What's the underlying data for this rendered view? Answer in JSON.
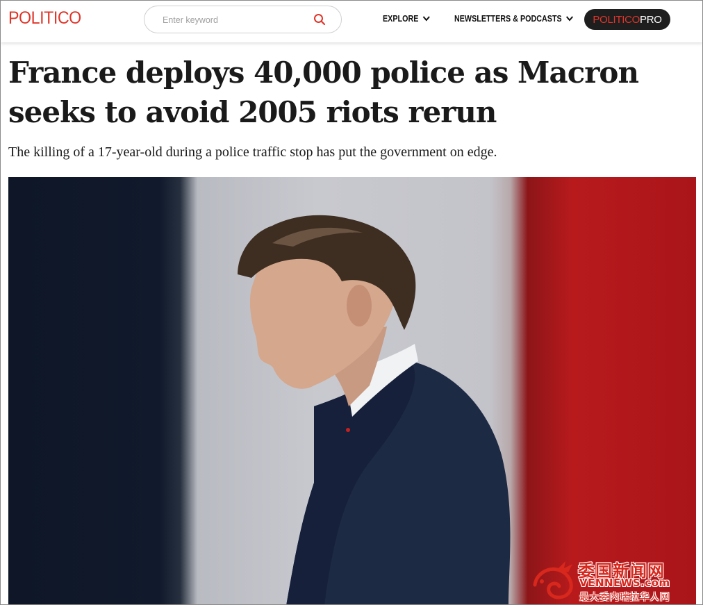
{
  "header": {
    "logo": "POLITICO",
    "search_placeholder": "Enter keyword",
    "nav": {
      "explore": "EXPLORE",
      "newsletters": "NEWSLETTERS & PODCASTS"
    },
    "pro": {
      "part1": "POLITICO",
      "part2": "PRO"
    }
  },
  "article": {
    "headline": "France deploys 40,000 police as Macron seeks to avoid 2005 riots rerun",
    "dek": "The killing of a 17-year-old during a police traffic stop has put the government on edge."
  },
  "watermark": {
    "title": "委国新闻网",
    "url": "VENNEWS.com",
    "subtitle": "最大委内瑞拉华人网"
  },
  "colors": {
    "brand_red": "#e0362a",
    "pro_bg": "#1e1e1e",
    "flag_blue": "#111a2c",
    "flag_red": "#b81a1c"
  },
  "icons": {
    "search": "search-icon",
    "chevron": "chevron-down-icon"
  }
}
